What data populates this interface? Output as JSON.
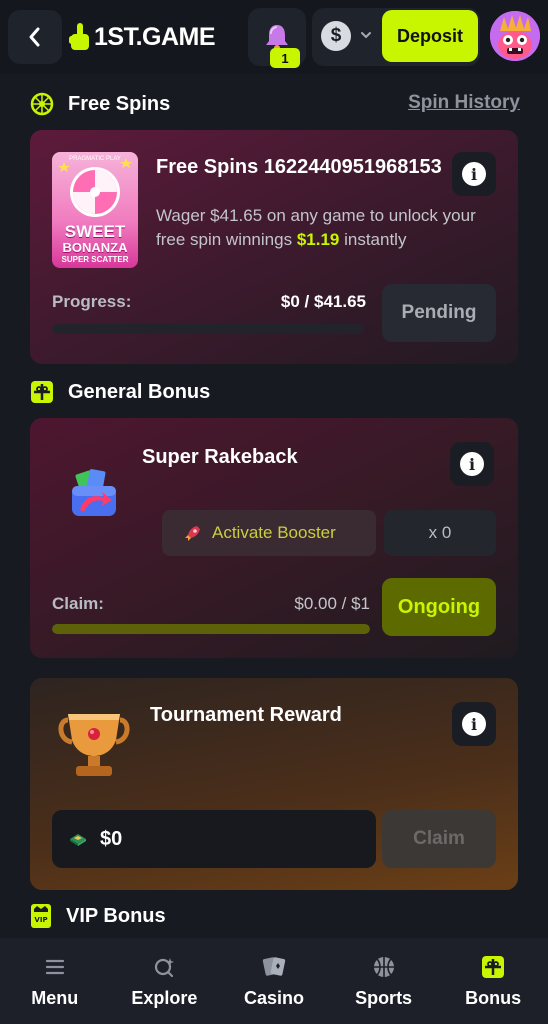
{
  "header": {
    "brand": "1ST.GAME",
    "notification_count": "1",
    "currency_symbol": "$",
    "deposit_label": "Deposit"
  },
  "free_spins_section": {
    "title": "Free Spins",
    "history_link": "Spin History",
    "card": {
      "thumb_provider": "PRAGMATIC PLAY",
      "thumb_line1": "SWEET",
      "thumb_line2": "BONANZA",
      "thumb_line3": "SUPER SCATTER",
      "title": "Free Spins 1622440951968153",
      "desc_prefix": "Wager $41.65 on any game to unlock your free spin winnings ",
      "desc_amount": "$1.19",
      "desc_suffix": " instantly",
      "progress_label": "Progress:",
      "progress_value": "$0 / $41.65",
      "progress_fraction": 0,
      "status_label": "Pending"
    }
  },
  "general_bonus_section": {
    "title": "General Bonus",
    "rakeback": {
      "title": "Super Rakeback",
      "booster_label": "Activate Booster",
      "multiplier": "x 0",
      "claim_label": "Claim:",
      "claim_value": "$0.00 / $1",
      "claim_fraction": 1,
      "status_label": "Ongoing"
    },
    "tournament": {
      "title": "Tournament Reward",
      "amount": "$0",
      "claim_button": "Claim"
    }
  },
  "vip_section": {
    "title": "VIP Bonus"
  },
  "bottom_nav": [
    {
      "label": "Menu",
      "icon": "menu-icon"
    },
    {
      "label": "Explore",
      "icon": "explore-icon"
    },
    {
      "label": "Casino",
      "icon": "cards-icon"
    },
    {
      "label": "Sports",
      "icon": "ball-icon"
    },
    {
      "label": "Bonus",
      "icon": "gift-icon"
    }
  ],
  "colors": {
    "accent": "#c8f500",
    "background": "#171a21",
    "card_surface": "#1f232c"
  }
}
